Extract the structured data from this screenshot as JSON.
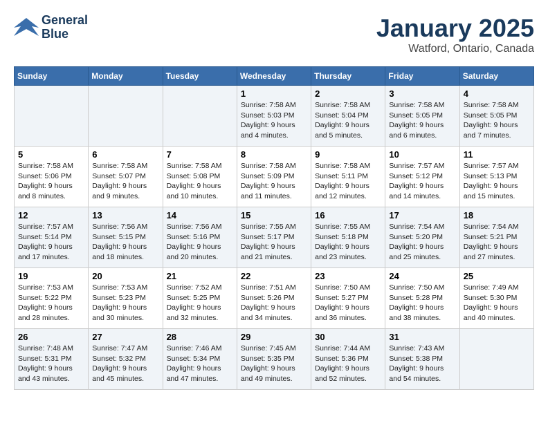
{
  "header": {
    "logo_line1": "General",
    "logo_line2": "Blue",
    "title": "January 2025",
    "subtitle": "Watford, Ontario, Canada"
  },
  "days_of_week": [
    "Sunday",
    "Monday",
    "Tuesday",
    "Wednesday",
    "Thursday",
    "Friday",
    "Saturday"
  ],
  "weeks": [
    [
      {
        "day": "",
        "info": ""
      },
      {
        "day": "",
        "info": ""
      },
      {
        "day": "",
        "info": ""
      },
      {
        "day": "1",
        "info": "Sunrise: 7:58 AM\nSunset: 5:03 PM\nDaylight: 9 hours\nand 4 minutes."
      },
      {
        "day": "2",
        "info": "Sunrise: 7:58 AM\nSunset: 5:04 PM\nDaylight: 9 hours\nand 5 minutes."
      },
      {
        "day": "3",
        "info": "Sunrise: 7:58 AM\nSunset: 5:05 PM\nDaylight: 9 hours\nand 6 minutes."
      },
      {
        "day": "4",
        "info": "Sunrise: 7:58 AM\nSunset: 5:05 PM\nDaylight: 9 hours\nand 7 minutes."
      }
    ],
    [
      {
        "day": "5",
        "info": "Sunrise: 7:58 AM\nSunset: 5:06 PM\nDaylight: 9 hours\nand 8 minutes."
      },
      {
        "day": "6",
        "info": "Sunrise: 7:58 AM\nSunset: 5:07 PM\nDaylight: 9 hours\nand 9 minutes."
      },
      {
        "day": "7",
        "info": "Sunrise: 7:58 AM\nSunset: 5:08 PM\nDaylight: 9 hours\nand 10 minutes."
      },
      {
        "day": "8",
        "info": "Sunrise: 7:58 AM\nSunset: 5:09 PM\nDaylight: 9 hours\nand 11 minutes."
      },
      {
        "day": "9",
        "info": "Sunrise: 7:58 AM\nSunset: 5:11 PM\nDaylight: 9 hours\nand 12 minutes."
      },
      {
        "day": "10",
        "info": "Sunrise: 7:57 AM\nSunset: 5:12 PM\nDaylight: 9 hours\nand 14 minutes."
      },
      {
        "day": "11",
        "info": "Sunrise: 7:57 AM\nSunset: 5:13 PM\nDaylight: 9 hours\nand 15 minutes."
      }
    ],
    [
      {
        "day": "12",
        "info": "Sunrise: 7:57 AM\nSunset: 5:14 PM\nDaylight: 9 hours\nand 17 minutes."
      },
      {
        "day": "13",
        "info": "Sunrise: 7:56 AM\nSunset: 5:15 PM\nDaylight: 9 hours\nand 18 minutes."
      },
      {
        "day": "14",
        "info": "Sunrise: 7:56 AM\nSunset: 5:16 PM\nDaylight: 9 hours\nand 20 minutes."
      },
      {
        "day": "15",
        "info": "Sunrise: 7:55 AM\nSunset: 5:17 PM\nDaylight: 9 hours\nand 21 minutes."
      },
      {
        "day": "16",
        "info": "Sunrise: 7:55 AM\nSunset: 5:18 PM\nDaylight: 9 hours\nand 23 minutes."
      },
      {
        "day": "17",
        "info": "Sunrise: 7:54 AM\nSunset: 5:20 PM\nDaylight: 9 hours\nand 25 minutes."
      },
      {
        "day": "18",
        "info": "Sunrise: 7:54 AM\nSunset: 5:21 PM\nDaylight: 9 hours\nand 27 minutes."
      }
    ],
    [
      {
        "day": "19",
        "info": "Sunrise: 7:53 AM\nSunset: 5:22 PM\nDaylight: 9 hours\nand 28 minutes."
      },
      {
        "day": "20",
        "info": "Sunrise: 7:53 AM\nSunset: 5:23 PM\nDaylight: 9 hours\nand 30 minutes."
      },
      {
        "day": "21",
        "info": "Sunrise: 7:52 AM\nSunset: 5:25 PM\nDaylight: 9 hours\nand 32 minutes."
      },
      {
        "day": "22",
        "info": "Sunrise: 7:51 AM\nSunset: 5:26 PM\nDaylight: 9 hours\nand 34 minutes."
      },
      {
        "day": "23",
        "info": "Sunrise: 7:50 AM\nSunset: 5:27 PM\nDaylight: 9 hours\nand 36 minutes."
      },
      {
        "day": "24",
        "info": "Sunrise: 7:50 AM\nSunset: 5:28 PM\nDaylight: 9 hours\nand 38 minutes."
      },
      {
        "day": "25",
        "info": "Sunrise: 7:49 AM\nSunset: 5:30 PM\nDaylight: 9 hours\nand 40 minutes."
      }
    ],
    [
      {
        "day": "26",
        "info": "Sunrise: 7:48 AM\nSunset: 5:31 PM\nDaylight: 9 hours\nand 43 minutes."
      },
      {
        "day": "27",
        "info": "Sunrise: 7:47 AM\nSunset: 5:32 PM\nDaylight: 9 hours\nand 45 minutes."
      },
      {
        "day": "28",
        "info": "Sunrise: 7:46 AM\nSunset: 5:34 PM\nDaylight: 9 hours\nand 47 minutes."
      },
      {
        "day": "29",
        "info": "Sunrise: 7:45 AM\nSunset: 5:35 PM\nDaylight: 9 hours\nand 49 minutes."
      },
      {
        "day": "30",
        "info": "Sunrise: 7:44 AM\nSunset: 5:36 PM\nDaylight: 9 hours\nand 52 minutes."
      },
      {
        "day": "31",
        "info": "Sunrise: 7:43 AM\nSunset: 5:38 PM\nDaylight: 9 hours\nand 54 minutes."
      },
      {
        "day": "",
        "info": ""
      }
    ]
  ]
}
